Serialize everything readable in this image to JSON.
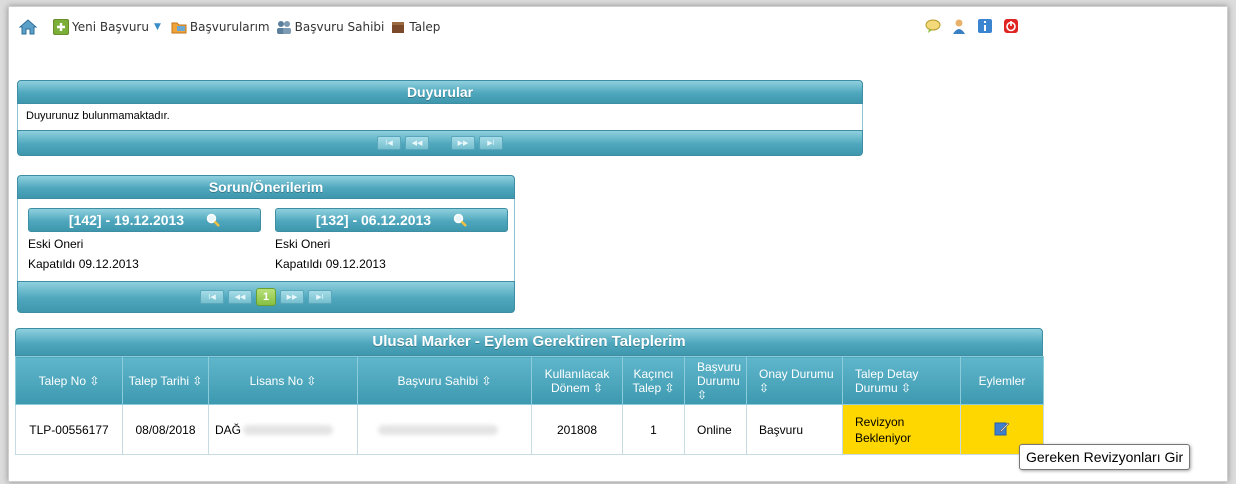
{
  "menu": {
    "items": [
      {
        "label": "Yeni Başvuru",
        "icon": "add-document-icon",
        "has_dropdown": true
      },
      {
        "label": "Başvurularım",
        "icon": "folder-icon"
      },
      {
        "label": "Başvuru Sahibi",
        "icon": "users-icon"
      },
      {
        "label": "Talep",
        "icon": "box-icon"
      }
    ],
    "right_icons": [
      "chat-icon",
      "user-icon",
      "info-icon",
      "power-icon"
    ]
  },
  "duyurular": {
    "title": "Duyurular",
    "empty_text": "Duyurunuz bulunmamaktadır."
  },
  "sorun": {
    "title": "Sorun/Önerilerim",
    "cards": [
      {
        "header": "[142] - 19.12.2013",
        "line1": "Eski Oneri",
        "line2": "Kapatıldı 09.12.2013"
      },
      {
        "header": "[132] - 06.12.2013",
        "line1": "Eski Oneri",
        "line2": "Kapatıldı 09.12.2013"
      }
    ],
    "current_page": "1"
  },
  "talepler": {
    "title": "Ulusal Marker - Eylem Gerektiren Taleplerim",
    "columns": [
      "Talep No ⇳",
      "Talep Tarihi ⇳",
      "Lisans No ⇳",
      "Başvuru Sahibi ⇳",
      "Kullanılacak Dönem ⇳",
      "Kaçıncı Talep ⇳",
      "Başvuru Durumu ⇳",
      "Onay Durumu ⇳",
      "Talep Detay Durumu ⇳",
      "Eylemler"
    ],
    "rows": [
      {
        "talep_no": "TLP-00556177",
        "talep_tarihi": "08/08/2018",
        "lisans_no": "DAĞ",
        "kullanilacak_donem": "201808",
        "kacinci_talep": "1",
        "basvuru_durumu": "Online",
        "onay_durumu": "Başvuru",
        "talep_detay_durumu": "Revizyon Bekleniyor"
      }
    ]
  },
  "tooltip": "Gereken Revizyonları Gir",
  "colors": {
    "header_teal": "#4fa7bd",
    "status_yellow": "#ffd700"
  }
}
